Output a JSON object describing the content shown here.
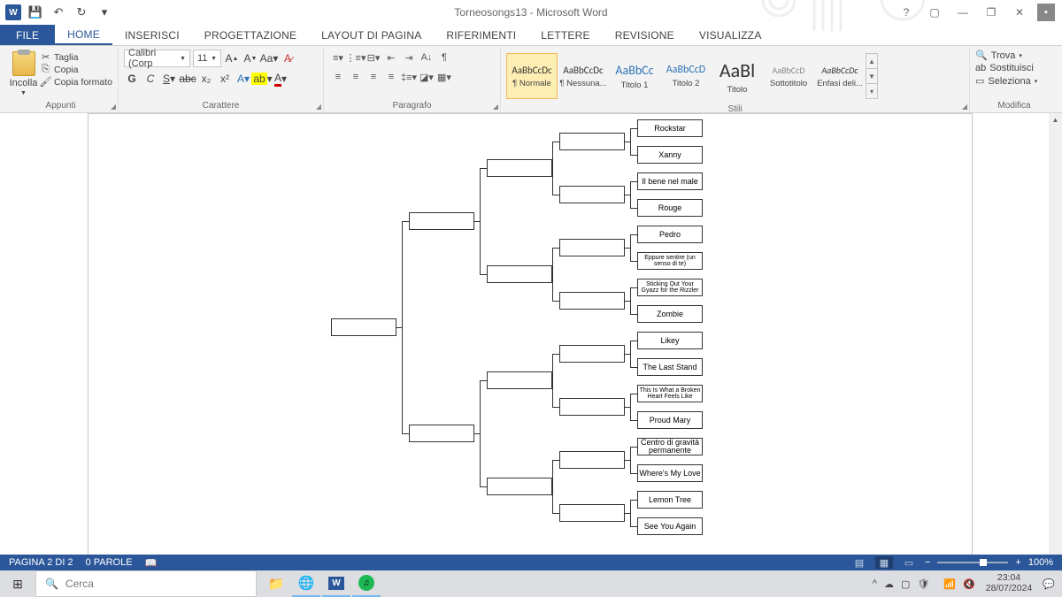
{
  "title": "Torneosongs13 - Microsoft Word",
  "qat": {
    "save": "💾",
    "undo": "↶",
    "redo": "↻"
  },
  "tabs": {
    "file": "FILE",
    "home": "HOME",
    "insert": "INSERISCI",
    "design": "PROGETTAZIONE",
    "layout": "LAYOUT DI PAGINA",
    "references": "RIFERIMENTI",
    "mailings": "LETTERE",
    "review": "REVISIONE",
    "view": "VISUALIZZA"
  },
  "ribbon": {
    "clipboard": {
      "paste": "Incolla",
      "cut": "Taglia",
      "copy": "Copia",
      "format_painter": "Copia formato",
      "label": "Appunti"
    },
    "font": {
      "name": "Calibri (Corp",
      "size": "11",
      "label": "Carattere"
    },
    "paragraph": {
      "label": "Paragrafo"
    },
    "styles": {
      "label": "Stili",
      "items": [
        {
          "preview": "AaBbCcDc",
          "name": "¶ Normale",
          "size": "11px"
        },
        {
          "preview": "AaBbCcDc",
          "name": "¶ Nessuna...",
          "size": "11px"
        },
        {
          "preview": "AaBbCc",
          "name": "Titolo 1",
          "size": "14px",
          "color": "#2e74b5"
        },
        {
          "preview": "AaBbCcD",
          "name": "Titolo 2",
          "size": "12px",
          "color": "#2e74b5"
        },
        {
          "preview": "AaBl",
          "name": "Titolo",
          "size": "22px"
        },
        {
          "preview": "AaBbCcD",
          "name": "Sottotitolo",
          "size": "10px",
          "color": "#888"
        },
        {
          "preview": "AaBbCcDc",
          "name": "Enfasi deli...",
          "size": "10px",
          "italic": true
        }
      ]
    },
    "editing": {
      "find": "Trova",
      "replace": "Sostituisci",
      "select": "Seleziona",
      "label": "Modifica"
    }
  },
  "bracket": {
    "r16": [
      "Rockstar",
      "Xanny",
      "Il bene nel male",
      "Rouge",
      "Pedro",
      "Eppure sentire (un senso di te)",
      "Sticking Out Your Gyazz for the Rizzler",
      "Zombie",
      "Likey",
      "The Last Stand",
      "This Is What a Broken Heart Feels Like",
      "Proud Mary",
      "Centro di gravità permanente",
      "Where's My Love",
      "Lemon Tree",
      "See You Again"
    ]
  },
  "status": {
    "page": "PAGINA 2 DI 2",
    "words": "0 PAROLE",
    "zoom": "100%"
  },
  "taskbar": {
    "search": "Cerca",
    "time": "23:04",
    "date": "28/07/2024"
  }
}
